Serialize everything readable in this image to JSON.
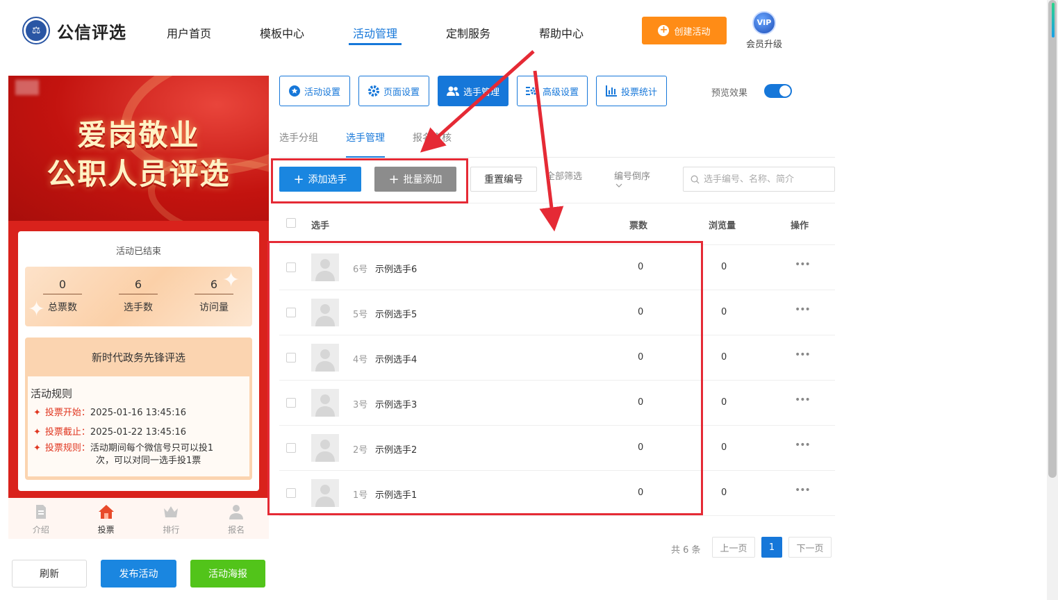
{
  "brand": {
    "name": "公信评选",
    "mark": "⚖"
  },
  "nav": {
    "items": [
      "用户首页",
      "模板中心",
      "活动管理",
      "定制服务",
      "帮助中心"
    ],
    "active_index": 2,
    "create_label": "创建活动",
    "vip_badge": "VIP",
    "vip_label": "会员升级"
  },
  "preview": {
    "banner_line1": "爱岗敬业",
    "banner_line2": "公职人员评选",
    "status": "活动已结束",
    "stats": [
      {
        "value": "0",
        "label": "总票数"
      },
      {
        "value": "6",
        "label": "选手数"
      },
      {
        "value": "6",
        "label": "访问量"
      }
    ],
    "rule_header": "新时代政务先锋评选",
    "rules_title": "活动规则",
    "rules": [
      {
        "label": "投票开始：",
        "text": "2025-01-16 13:45:16"
      },
      {
        "label": "投票截止：",
        "text": "2025-01-22 13:45:16"
      },
      {
        "label": "投票规则：",
        "text": "活动期间每个微信号只可以投1",
        "text2": "次，可以对同一选手投1票"
      }
    ],
    "tabbar": [
      {
        "label": "介绍",
        "icon": "doc-icon"
      },
      {
        "label": "投票",
        "icon": "home-icon"
      },
      {
        "label": "排行",
        "icon": "crown-icon"
      },
      {
        "label": "报名",
        "icon": "user-icon"
      }
    ],
    "tabbar_active_index": 1
  },
  "bottom_buttons": {
    "refresh": "刷新",
    "publish": "发布活动",
    "poster": "活动海报"
  },
  "toolbar": {
    "buttons": [
      "活动设置",
      "页面设置",
      "选手管理",
      "高级设置",
      "投票统计"
    ],
    "active_index": 2,
    "preview_label": "预览效果",
    "preview_on": true
  },
  "subtabs": {
    "items": [
      "选手分组",
      "选手管理",
      "报名审核"
    ],
    "active_index": 1
  },
  "actions": {
    "add": "添加选手",
    "batch_add": "批量添加",
    "reset_numbers": "重置编号",
    "filter_all": "全部筛选",
    "sort": "编号倒序",
    "search_placeholder": "选手编号、名称、简介"
  },
  "table": {
    "headers": {
      "player": "选手",
      "votes": "票数",
      "views": "浏览量",
      "ops": "操作"
    },
    "rows": [
      {
        "num": "6号",
        "name": "示例选手6",
        "votes": "0",
        "views": "0"
      },
      {
        "num": "5号",
        "name": "示例选手5",
        "votes": "0",
        "views": "0"
      },
      {
        "num": "4号",
        "name": "示例选手4",
        "votes": "0",
        "views": "0"
      },
      {
        "num": "3号",
        "name": "示例选手3",
        "votes": "0",
        "views": "0"
      },
      {
        "num": "2号",
        "name": "示例选手2",
        "votes": "0",
        "views": "0"
      },
      {
        "num": "1号",
        "name": "示例选手1",
        "votes": "0",
        "views": "0"
      }
    ],
    "more_glyph": "•••"
  },
  "pagination": {
    "total": "共 6 条",
    "prev": "上一页",
    "current": "1",
    "next": "下一页"
  },
  "colors": {
    "primary": "#1677d9",
    "orange": "#ff8c16",
    "green": "#52c41a",
    "annotation_red": "#e52a35"
  }
}
